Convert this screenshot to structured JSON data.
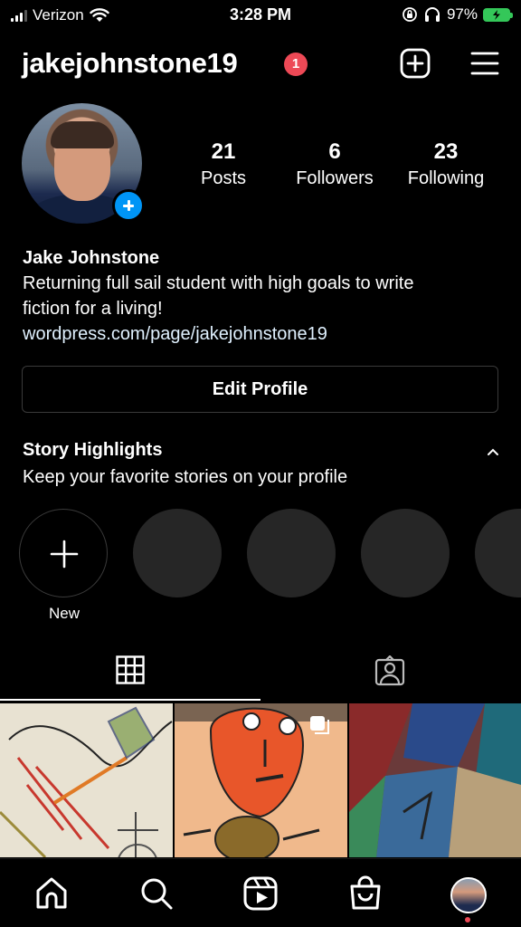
{
  "status_bar": {
    "carrier": "Verizon",
    "time": "3:28 PM",
    "battery_percent": "97%"
  },
  "header": {
    "username": "jakejohnstone19",
    "notification_count": "1",
    "create_icon": "plus-square-icon",
    "menu_icon": "hamburger-menu-icon"
  },
  "profile": {
    "stats": [
      {
        "count": "21",
        "label": "Posts"
      },
      {
        "count": "6",
        "label": "Followers"
      },
      {
        "count": "23",
        "label": "Following"
      }
    ],
    "name": "Jake Johnstone",
    "bio_line1": "Returning full sail student with high goals to write",
    "bio_line2": "fiction for a living!",
    "link": "wordpress.com/page/jakejohnstone19",
    "edit_button": "Edit Profile"
  },
  "highlights": {
    "title": "Story Highlights",
    "subtitle": "Keep your favorite stories on your profile",
    "new_label": "New"
  },
  "tabs": {
    "grid_icon": "grid-icon",
    "tagged_icon": "tagged-person-icon"
  },
  "bottom_nav": {
    "items": [
      "home-icon",
      "search-icon",
      "reels-icon",
      "shop-icon",
      "profile-avatar"
    ]
  },
  "colors": {
    "background": "#000000",
    "badge": "#ed4956",
    "accent_blue": "#0095f6",
    "battery": "#34c759",
    "highlight_placeholder": "#262626"
  }
}
